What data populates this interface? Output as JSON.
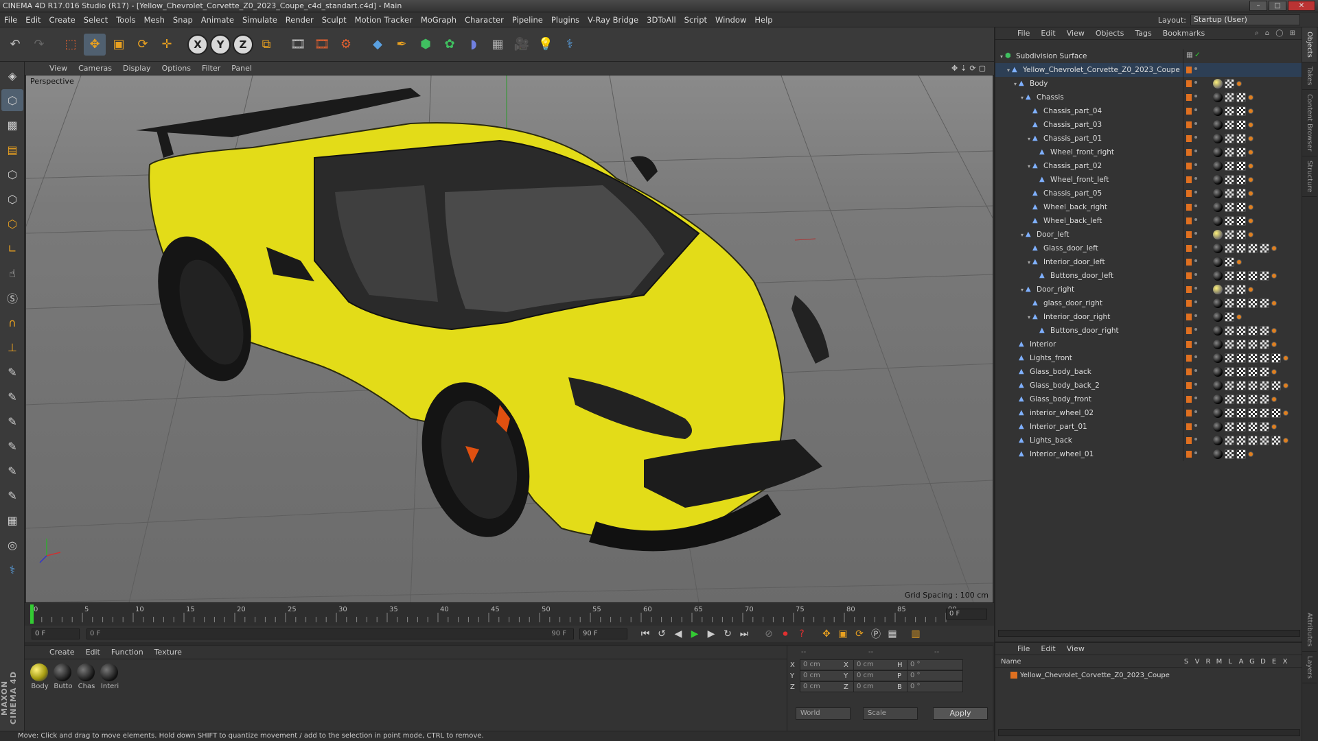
{
  "window": {
    "title": "CINEMA 4D R17.016 Studio (R17) - [Yellow_Chevrolet_Corvette_Z0_2023_Coupe_c4d_standart.c4d] - Main",
    "buttons": [
      "–",
      "□",
      "✕"
    ]
  },
  "menubar": {
    "items": [
      "File",
      "Edit",
      "Create",
      "Select",
      "Tools",
      "Mesh",
      "Snap",
      "Animate",
      "Simulate",
      "Render",
      "Sculpt",
      "Motion Tracker",
      "MoGraph",
      "Character",
      "Pipeline",
      "Plugins",
      "V-Ray Bridge",
      "3DToAll",
      "Script",
      "Window",
      "Help"
    ],
    "layout_label": "Layout:",
    "layout_value": "Startup (User)"
  },
  "toolbar": {
    "icons": [
      "undo-icon",
      "redo-icon",
      "live-selection-icon",
      "move-icon",
      "scale-icon",
      "rotate-icon",
      "last-tool-icon",
      "x-axis-icon",
      "y-axis-icon",
      "z-axis-icon",
      "coordinate-system-icon",
      "render-view-icon",
      "render-picture-viewer-icon",
      "render-settings-icon",
      "cube-icon",
      "pen-spline-icon",
      "subdivision-icon",
      "cloner-icon",
      "deformer-icon",
      "floor-icon",
      "camera-icon",
      "light-icon",
      "python-icon"
    ],
    "axes": [
      "X",
      "Y",
      "Z"
    ]
  },
  "viewport": {
    "menu": [
      "View",
      "Cameras",
      "Display",
      "Options",
      "Filter",
      "Panel"
    ],
    "camera_label": "Perspective",
    "grid_spacing": "Grid Spacing : 100 cm"
  },
  "timeline": {
    "ticks": [
      "0",
      "5",
      "10",
      "15",
      "20",
      "25",
      "30",
      "35",
      "40",
      "45",
      "50",
      "55",
      "60",
      "65",
      "70",
      "75",
      "80",
      "85",
      "90"
    ],
    "current_frame": "0 F",
    "start_field": "0 F",
    "range_start": "0 F",
    "range_end": "90 F",
    "end_field": "90 F"
  },
  "materials": {
    "menu": [
      "Create",
      "Edit",
      "Function",
      "Texture"
    ],
    "items": [
      {
        "name": "Body",
        "color": "yellow"
      },
      {
        "name": "Butto",
        "color": "black"
      },
      {
        "name": "Chas",
        "color": "black"
      },
      {
        "name": "Interi",
        "color": "black"
      }
    ]
  },
  "coordinates": {
    "headers": [
      "--",
      "--",
      "--"
    ],
    "rows": [
      {
        "a": "X",
        "av": "0 cm",
        "b": "X",
        "bv": "0 cm",
        "c": "H",
        "cv": "0 °"
      },
      {
        "a": "Y",
        "av": "0 cm",
        "b": "Y",
        "bv": "0 cm",
        "c": "P",
        "cv": "0 °"
      },
      {
        "a": "Z",
        "av": "0 cm",
        "b": "Z",
        "bv": "0 cm",
        "c": "B",
        "cv": "0 °"
      }
    ],
    "mode": "World",
    "size_mode": "Scale",
    "apply": "Apply"
  },
  "status": "Move: Click and drag to move elements. Hold down SHIFT to quantize movement / add to the selection in point mode, CTRL to remove.",
  "brand": "MAXON CINEMA 4D",
  "objects": {
    "menu": [
      "File",
      "Edit",
      "View",
      "Objects",
      "Tags",
      "Bookmarks"
    ],
    "rows": [
      {
        "name": "Subdivision Surface",
        "depth": 0,
        "exp": "−",
        "tags": "sds"
      },
      {
        "name": "Yellow_Chevrolet_Corvette_Z0_2023_Coupe",
        "depth": 1,
        "exp": "−",
        "tags": "none"
      },
      {
        "name": "Body",
        "depth": 2,
        "exp": "−",
        "tags": "y3"
      },
      {
        "name": "Chassis",
        "depth": 3,
        "exp": "−",
        "tags": "b4"
      },
      {
        "name": "Chassis_part_04",
        "depth": 4,
        "exp": "",
        "tags": "b4"
      },
      {
        "name": "Chassis_part_03",
        "depth": 4,
        "exp": "",
        "tags": "b4"
      },
      {
        "name": "Chassis_part_01",
        "depth": 4,
        "exp": "−",
        "tags": "b4"
      },
      {
        "name": "Wheel_front_right",
        "depth": 5,
        "exp": "",
        "tags": "b4"
      },
      {
        "name": "Chassis_part_02",
        "depth": 4,
        "exp": "−",
        "tags": "b4"
      },
      {
        "name": "Wheel_front_left",
        "depth": 5,
        "exp": "",
        "tags": "b4"
      },
      {
        "name": "Chassis_part_05",
        "depth": 4,
        "exp": "",
        "tags": "b4"
      },
      {
        "name": "Wheel_back_right",
        "depth": 4,
        "exp": "",
        "tags": "b4"
      },
      {
        "name": "Wheel_back_left",
        "depth": 4,
        "exp": "",
        "tags": "b4"
      },
      {
        "name": "Door_left",
        "depth": 3,
        "exp": "−",
        "tags": "y4"
      },
      {
        "name": "Glass_door_left",
        "depth": 4,
        "exp": "",
        "tags": "b6"
      },
      {
        "name": "Interior_door_left",
        "depth": 4,
        "exp": "−",
        "tags": "b3"
      },
      {
        "name": "Buttons_door_left",
        "depth": 5,
        "exp": "",
        "tags": "b6"
      },
      {
        "name": "Door_right",
        "depth": 3,
        "exp": "−",
        "tags": "y4"
      },
      {
        "name": "glass_door_right",
        "depth": 4,
        "exp": "",
        "tags": "b6"
      },
      {
        "name": "Interior_door_right",
        "depth": 4,
        "exp": "−",
        "tags": "b3"
      },
      {
        "name": "Buttons_door_right",
        "depth": 5,
        "exp": "",
        "tags": "b6"
      },
      {
        "name": "Interior",
        "depth": 2,
        "exp": "",
        "tags": "b6"
      },
      {
        "name": "Lights_front",
        "depth": 2,
        "exp": "",
        "tags": "b7"
      },
      {
        "name": "Glass_body_back",
        "depth": 2,
        "exp": "",
        "tags": "b6"
      },
      {
        "name": "Glass_body_back_2",
        "depth": 2,
        "exp": "",
        "tags": "b7"
      },
      {
        "name": "Glass_body_front",
        "depth": 2,
        "exp": "",
        "tags": "b6"
      },
      {
        "name": "interior_wheel_02",
        "depth": 2,
        "exp": "",
        "tags": "b7"
      },
      {
        "name": "Interior_part_01",
        "depth": 2,
        "exp": "",
        "tags": "b6"
      },
      {
        "name": "Lights_back",
        "depth": 2,
        "exp": "",
        "tags": "b7"
      },
      {
        "name": "Interior_wheel_01",
        "depth": 2,
        "exp": "",
        "tags": "b4"
      }
    ]
  },
  "attributes": {
    "menu": [
      "File",
      "Edit",
      "View"
    ],
    "name_header": "Name",
    "columns": [
      "S",
      "V",
      "R",
      "M",
      "L",
      "A",
      "G",
      "D",
      "E",
      "X"
    ],
    "object": "Yellow_Chevrolet_Corvette_Z0_2023_Coupe"
  },
  "side_tabs": [
    "Objects",
    "Takes",
    "Content Browser",
    "Structure",
    "Attributes",
    "Layers"
  ],
  "colors": {
    "car_body": "#e6e01a",
    "accent_orange": "#e07020",
    "selection": "#2d3f55"
  }
}
